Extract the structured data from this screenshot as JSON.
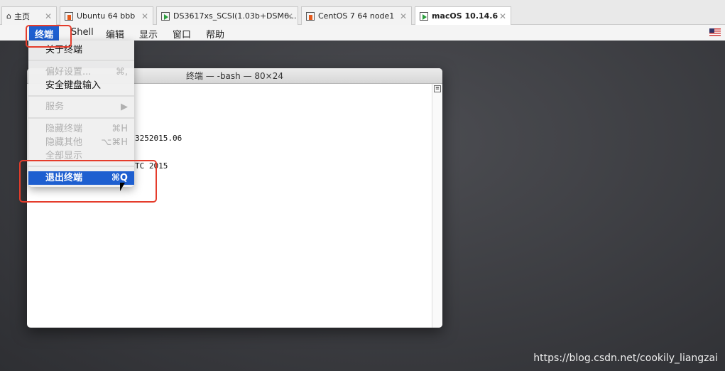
{
  "tabs": [
    {
      "label": "主页",
      "icon": "home-icon"
    },
    {
      "label": "Ubuntu 64 bbb",
      "icon": "vm-icon"
    },
    {
      "label": "DS3617xs_SCSI(1.03b+DSM6...",
      "icon": "vm-running-icon"
    },
    {
      "label": "CentOS 7 64 node1",
      "icon": "vm-icon"
    },
    {
      "label": "macOS 10.14.6",
      "icon": "vm-running-icon",
      "active": true
    }
  ],
  "menubar": {
    "apple": "",
    "items": [
      "终端",
      "Shell",
      "编辑",
      "显示",
      "窗口",
      "帮助"
    ]
  },
  "terminal": {
    "title": "终端 — -bash — 80×24",
    "lines": [
      "3252015.06",
      "TC 2015"
    ]
  },
  "menu": {
    "items": [
      {
        "label": "关于终端"
      },
      {
        "label": "偏好设置...",
        "shortcut": "⌘,",
        "disabled": true
      },
      {
        "label": "安全键盘输入"
      },
      {
        "label": "服务",
        "shortcut": "▶",
        "disabled": true
      },
      {
        "label": "隐藏终端",
        "shortcut": "⌘H",
        "disabled": true
      },
      {
        "label": "隐藏其他",
        "shortcut": "⌥⌘H",
        "disabled": true
      },
      {
        "label": "全部显示",
        "disabled": true
      },
      {
        "label": "退出终端",
        "shortcut": "⌘Q",
        "highlighted": true
      }
    ]
  },
  "watermark": "https://blog.csdn.net/cookily_liangzai",
  "colors": {
    "highlight": "#1e5fd0",
    "annotation": "#e53c2b"
  }
}
